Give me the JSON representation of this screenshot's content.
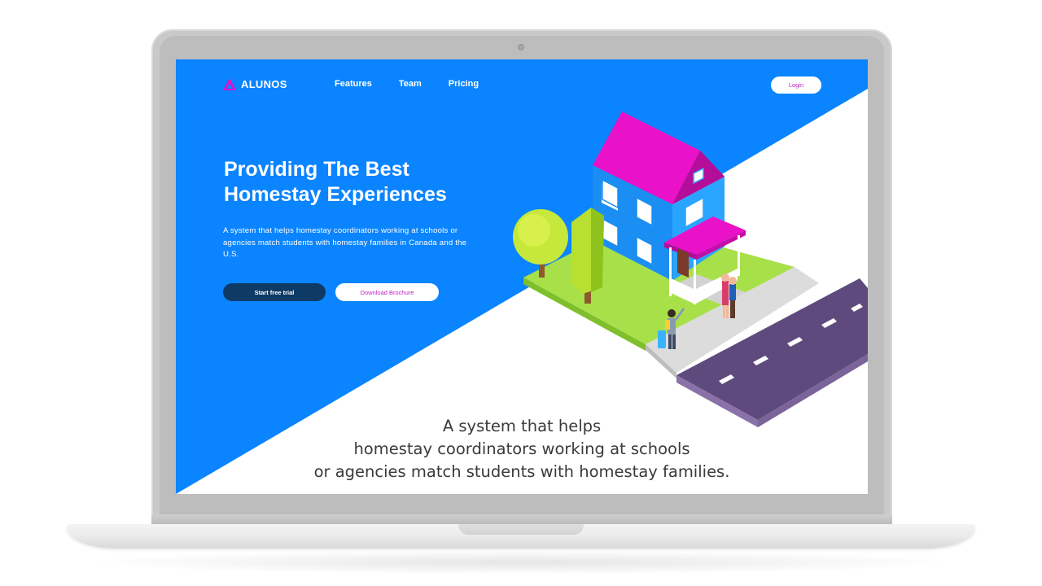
{
  "colors": {
    "primary_blue": "#0a84ff",
    "accent_magenta": "#e30fc6",
    "dark_navy": "#0e3b66",
    "text_gray": "#3a3a3a"
  },
  "brand": {
    "name": "ALUNOS",
    "logo_icon": "triangle-logo-icon"
  },
  "nav": {
    "items": [
      {
        "label": "Features"
      },
      {
        "label": "Team"
      },
      {
        "label": "Pricing"
      }
    ],
    "login_label": "Login"
  },
  "hero": {
    "title_line1": "Providing The Best",
    "title_line2": "Homestay Experiences",
    "description": "A system that helps homestay coordinators working at schools or agencies match students with homestay families in Canada and the U.S.",
    "primary_cta": "Start free trial",
    "secondary_cta": "Download Brochure"
  },
  "tagline": {
    "line1": "A system that helps",
    "line2": "homestay coordinators working at schools",
    "line3": "or agencies match students with homestay families."
  },
  "illustration": {
    "icon": "isometric-house-illustration"
  }
}
